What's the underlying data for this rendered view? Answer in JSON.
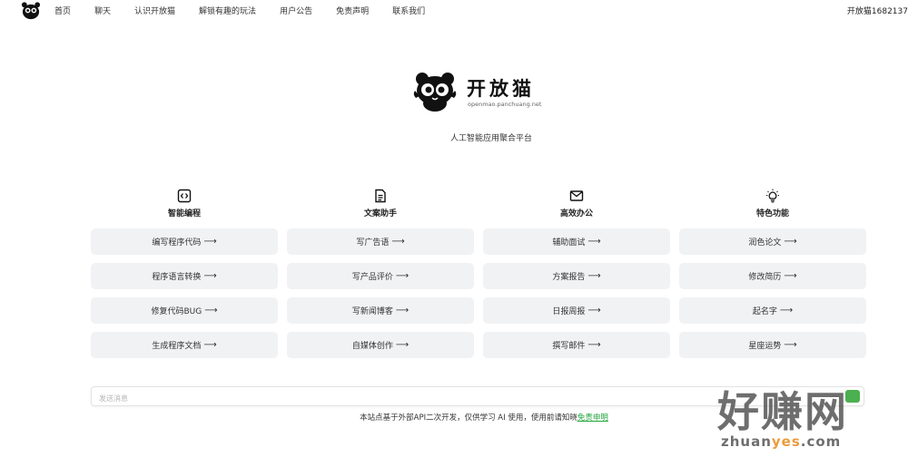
{
  "nav": {
    "items": [
      "首页",
      "聊天",
      "认识开放猫",
      "解锁有趣的玩法",
      "用户公告",
      "免责声明",
      "联系我们"
    ],
    "user_label": "开放猫1682137"
  },
  "brand": {
    "name": "开放猫",
    "domain": "openmao.panchuang.net",
    "tagline": "人工智能应用聚合平台"
  },
  "columns": [
    {
      "icon": "code-icon",
      "title": "智能编程",
      "items": [
        "编写程序代码",
        "程序语言转换",
        "修复代码BUG",
        "生成程序文档"
      ]
    },
    {
      "icon": "document-icon",
      "title": "文案助手",
      "items": [
        "写广告语",
        "写产品评价",
        "写新闻博客",
        "自媒体创作"
      ]
    },
    {
      "icon": "mail-icon",
      "title": "高效办公",
      "items": [
        "辅助面试",
        "方案报告",
        "日报周报",
        "撰写邮件"
      ]
    },
    {
      "icon": "lightbulb-icon",
      "title": "特色功能",
      "items": [
        "润色论文",
        "修改简历",
        "起名字",
        "星座运势"
      ]
    }
  ],
  "arrow": "⟶",
  "message": {
    "placeholder": "发送消息"
  },
  "disclaimer": {
    "text": "本站点基于外部API二次开发，仅供学习 AI 使用，使用前请知晓",
    "link": "免责申明"
  },
  "watermark": {
    "big": "好赚网",
    "small_pre": "zhuan",
    "small_hl": "yes",
    "small_post": ".com"
  },
  "colors": {
    "accent": "#20a53a",
    "item_bg": "#f1f2f4",
    "watermark_highlight": "#e88a1a"
  }
}
